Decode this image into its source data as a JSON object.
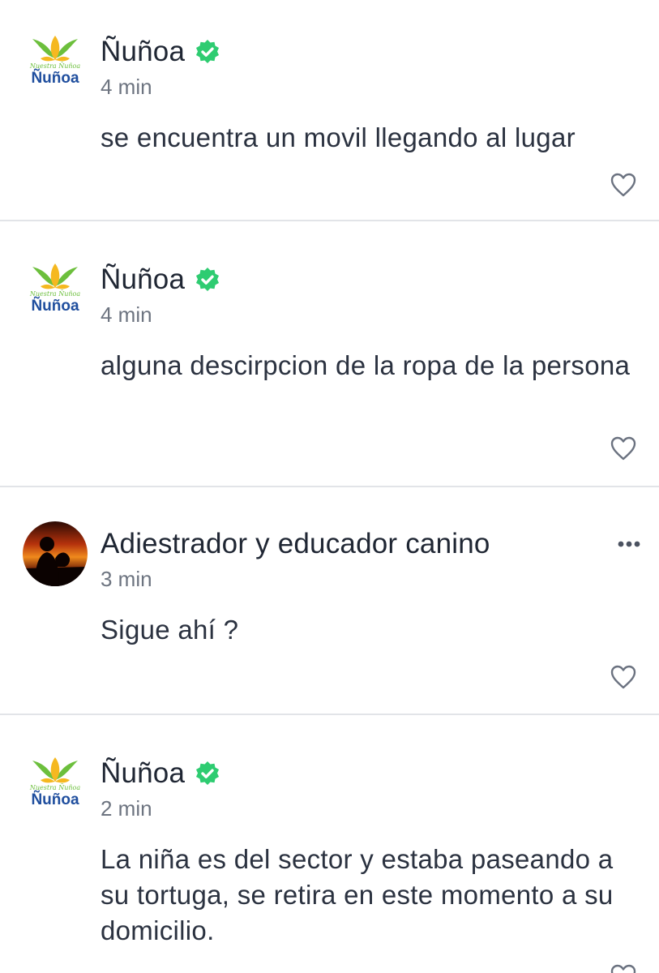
{
  "colors": {
    "verified": "#2ecc71",
    "divider": "#e2e4e8",
    "author": "#1f2633",
    "time": "#6d7480",
    "body": "#2b3240",
    "logo_blue": "#1f4e9e",
    "logo_yellow": "#f5b820",
    "logo_green": "#6cbf3c"
  },
  "comments": [
    {
      "author": "Ñuñoa",
      "verified": true,
      "time": "4 min",
      "text": "se encuentra un movil llegando al lugar",
      "avatar": {
        "logo_text": "Ñuñoa",
        "tagline": "Nuestra Ñuñoa"
      },
      "icons": {
        "like": "heart-outline-icon"
      }
    },
    {
      "author": "Ñuñoa",
      "verified": true,
      "time": "4 min",
      "text": "alguna descirpcion de la ropa de la persona",
      "avatar": {
        "logo_text": "Ñuñoa",
        "tagline": "Nuestra Ñuñoa"
      },
      "icons": {
        "like": "heart-outline-icon"
      }
    },
    {
      "author": "Adiestrador y educador canino",
      "verified": false,
      "time": "3 min",
      "text": "Sigue ahí ?",
      "icons": {
        "like": "heart-outline-icon",
        "more": "more-dots-icon"
      }
    },
    {
      "author": "Ñuñoa",
      "verified": true,
      "time": "2 min",
      "text": "La niña es del sector y estaba paseando a su tortuga, se retira en este momento a su domicilio.",
      "avatar": {
        "logo_text": "Ñuñoa",
        "tagline": "Nuestra Ñuñoa"
      },
      "icons": {
        "like": "heart-outline-icon"
      }
    }
  ]
}
